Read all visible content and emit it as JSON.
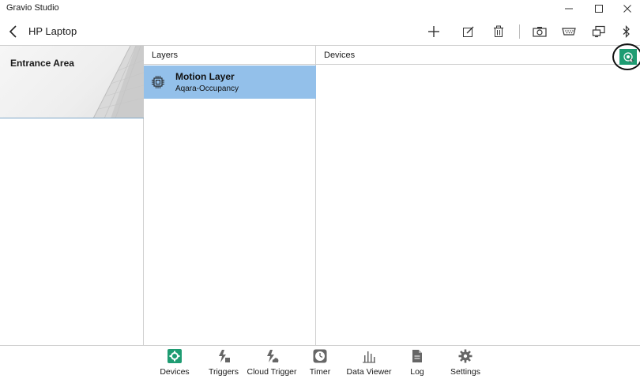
{
  "window": {
    "title": "Gravio Studio"
  },
  "header": {
    "title": "HP Laptop",
    "toolbar": [
      {
        "name": "add-button",
        "icon": "plus-icon"
      },
      {
        "name": "edit-button",
        "icon": "edit-icon"
      },
      {
        "name": "delete-button",
        "icon": "trash-icon"
      },
      {
        "name": "camera-button",
        "icon": "camera-icon"
      },
      {
        "name": "serial-button",
        "icon": "serial-port-icon"
      },
      {
        "name": "screen-button",
        "icon": "screen-icon"
      },
      {
        "name": "bluetooth-button",
        "icon": "bluetooth-icon"
      }
    ]
  },
  "areas": {
    "items": [
      {
        "label": "Entrance Area",
        "selected": true
      }
    ]
  },
  "layers": {
    "header": "Layers",
    "items": [
      {
        "name": "Motion Layer",
        "type": "Aqara-Occupancy",
        "icon": "chip-icon",
        "selected": true
      }
    ]
  },
  "devices": {
    "header": "Devices",
    "add_button_icon": "add-device-icon"
  },
  "nav": {
    "items": [
      {
        "label": "Devices",
        "icon": "gear-box-icon",
        "active": true
      },
      {
        "label": "Triggers",
        "icon": "trigger-icon",
        "active": false
      },
      {
        "label": "Cloud Trigger",
        "icon": "cloud-trigger-icon",
        "active": false
      },
      {
        "label": "Timer",
        "icon": "clock-icon",
        "active": false
      },
      {
        "label": "Data Viewer",
        "icon": "bar-chart-icon",
        "active": false
      },
      {
        "label": "Log",
        "icon": "document-icon",
        "active": false
      },
      {
        "label": "Settings",
        "icon": "gear-icon",
        "active": false
      }
    ]
  },
  "colors": {
    "selection": "#93c0ea",
    "accent_green": "#1e9c72",
    "divider": "#cfcfcf"
  }
}
